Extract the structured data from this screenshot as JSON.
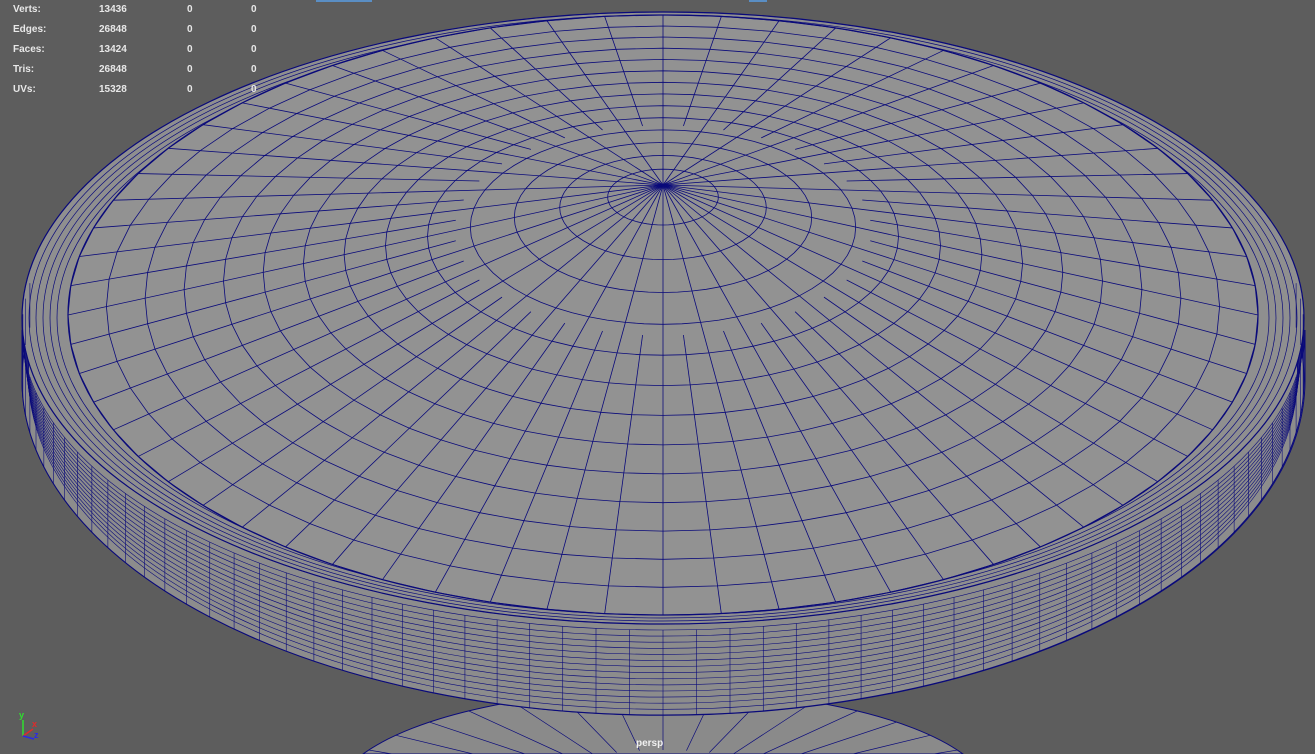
{
  "hud": {
    "rows": [
      {
        "label": "Verts:",
        "v1": "13436",
        "v2": "0",
        "v3": "0"
      },
      {
        "label": "Edges:",
        "v1": "26848",
        "v2": "0",
        "v3": "0"
      },
      {
        "label": "Faces:",
        "v1": "13424",
        "v2": "0",
        "v3": "0"
      },
      {
        "label": "Tris:",
        "v1": "26848",
        "v2": "0",
        "v3": "0"
      },
      {
        "label": "UVs:",
        "v1": "15328",
        "v2": "0",
        "v3": "0"
      }
    ]
  },
  "camera": "persp",
  "axis": {
    "x": "x",
    "y": "y",
    "z": "z"
  },
  "colors": {
    "background": "#5d5d5d",
    "mesh": "#8f8f8f",
    "wire": "#0a0a7a"
  }
}
